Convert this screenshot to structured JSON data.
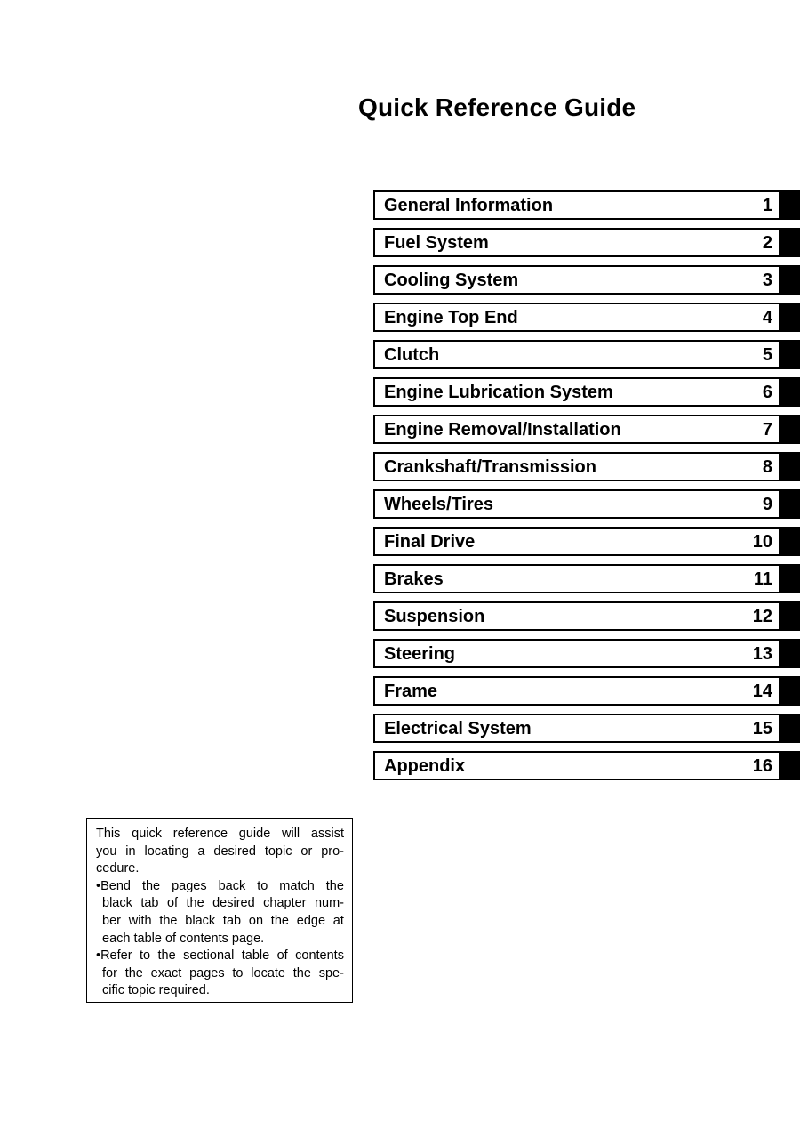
{
  "page": {
    "title": "Quick Reference Guide"
  },
  "chapters": [
    {
      "title": "General Information",
      "number": "1"
    },
    {
      "title": "Fuel System",
      "number": "2"
    },
    {
      "title": "Cooling System",
      "number": "3"
    },
    {
      "title": "Engine Top End",
      "number": "4"
    },
    {
      "title": "Clutch",
      "number": "5"
    },
    {
      "title": "Engine Lubrication System",
      "number": "6"
    },
    {
      "title": "Engine Removal/Installation",
      "number": "7"
    },
    {
      "title": "Crankshaft/Transmission",
      "number": "8"
    },
    {
      "title": "Wheels/Tires",
      "number": "9"
    },
    {
      "title": "Final Drive",
      "number": "10"
    },
    {
      "title": "Brakes",
      "number": "11"
    },
    {
      "title": "Suspension",
      "number": "12"
    },
    {
      "title": "Steering",
      "number": "13"
    },
    {
      "title": "Frame",
      "number": "14"
    },
    {
      "title": "Electrical System",
      "number": "15"
    },
    {
      "title": "Appendix",
      "number": "16"
    }
  ],
  "note": {
    "bullet_glyph": "•",
    "lines": [
      {
        "type": "justified",
        "words": [
          "This",
          "quick",
          "reference",
          "guide",
          "will",
          "assist"
        ]
      },
      {
        "type": "justified",
        "words": [
          "you",
          "in",
          "locating",
          "a",
          "desired",
          "topic",
          "or",
          "pro-"
        ]
      },
      {
        "type": "plain",
        "text": "cedure."
      },
      {
        "type": "bullet",
        "words": [
          "Bend",
          "the",
          "pages",
          "back",
          "to",
          "match",
          "the"
        ]
      },
      {
        "type": "justified-indent",
        "words": [
          "black",
          "tab",
          "of",
          "the",
          "desired",
          "chapter",
          "num-"
        ]
      },
      {
        "type": "justified-indent",
        "words": [
          "ber",
          "with",
          "the",
          "black",
          "tab",
          "on",
          "the",
          "edge",
          "at"
        ]
      },
      {
        "type": "plain-indent",
        "text": "each table of contents page."
      },
      {
        "type": "bullet",
        "words": [
          "Refer",
          "to",
          "the",
          "sectional",
          "table",
          "of",
          "contents"
        ]
      },
      {
        "type": "justified-indent",
        "words": [
          "for",
          "the",
          "exact",
          "pages",
          "to",
          "locate",
          "the",
          "spe-"
        ]
      },
      {
        "type": "plain-indent",
        "text": "cific topic required."
      }
    ],
    "full_text": "This quick reference guide will assist you in locating a desired topic or procedure. •Bend the pages back to match the black tab of the desired chapter number with the black tab on the edge at each table of contents page. •Refer to the sectional table of contents for the exact pages to locate the specific topic required."
  },
  "colors": {
    "ink": "#000000",
    "paper": "#ffffff",
    "tab": "#000000"
  }
}
